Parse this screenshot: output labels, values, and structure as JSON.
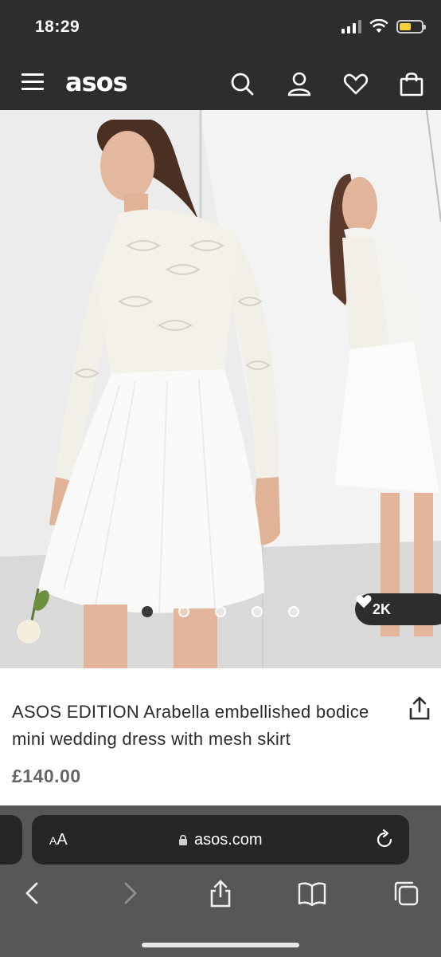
{
  "status_bar": {
    "time": "18:29"
  },
  "header": {
    "logo": "asos"
  },
  "hero": {
    "carousel_dot_count": 5,
    "active_dot_index": 0,
    "saves_count": "2K"
  },
  "product": {
    "title": "ASOS EDITION Arabella embellished bodice mini wedding dress with mesh skirt",
    "price": "£140.00"
  },
  "browser": {
    "aa_label_big": "A",
    "aa_label_small": "A",
    "aa_prefix": "",
    "domain": "asos.com"
  },
  "icons": {
    "menu": "hamburger-icon",
    "search": "search-icon",
    "account": "user-icon",
    "saved": "heart-icon",
    "bag": "bag-icon",
    "share": "share-icon",
    "lock": "lock-icon",
    "reload": "reload-icon"
  },
  "colors": {
    "header_bg": "#2d2d2d",
    "safari_bg": "#555759",
    "price": "#666666"
  }
}
